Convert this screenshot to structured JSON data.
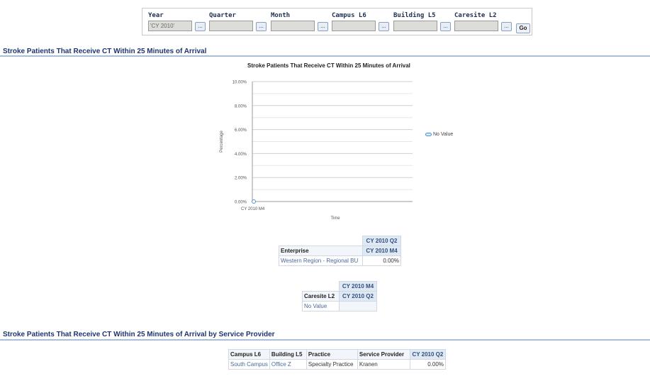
{
  "prompts": {
    "year": {
      "label": "Year",
      "value": "'CY 2010'"
    },
    "quarter": {
      "label": "Quarter",
      "value": ""
    },
    "month": {
      "label": "Month",
      "value": ""
    },
    "campus_l6": {
      "label": "Campus L6",
      "value": ""
    },
    "building_l5": {
      "label": "Building L5",
      "value": ""
    },
    "caresite_l2": {
      "label": "Caresite L2",
      "value": ""
    },
    "browse_label": "...",
    "go_label": "Go"
  },
  "section1": {
    "title": "Stroke Patients That Receive CT Within 25 Minutes of Arrival"
  },
  "chart_data": {
    "type": "line",
    "title": "Stroke Patients That Receive CT Within 25 Minutes of Arrival",
    "xlabel": "Time",
    "ylabel": "Percentage",
    "categories": [
      "CY 2010 M4"
    ],
    "series": [
      {
        "name": "No Value",
        "values": [
          0.0
        ]
      }
    ],
    "ylim": [
      0,
      10
    ],
    "yticks": [
      "0.00%",
      "2.00%",
      "4.00%",
      "6.00%",
      "8.00%",
      "10.00%"
    ],
    "grid": true,
    "legend": "right",
    "series_color": "#4a90d9"
  },
  "table1": {
    "col_top": "CY 2010 Q2",
    "row_header": "Enterprise",
    "col_sub": "CY 2010 M4",
    "rows": [
      {
        "label": "Western Region - Regional BU",
        "value": "0.00%"
      }
    ]
  },
  "table2": {
    "col_top": "CY 2010 M4",
    "row_header": "Caresite L2",
    "col_sub": "CY 2010 Q2",
    "rows": [
      {
        "label": "No Value",
        "value": ""
      }
    ]
  },
  "section2": {
    "title": "Stroke Patients That Receive CT Within 25 Minutes of Arrival by Service Provider"
  },
  "table3": {
    "headers": [
      "Campus L6",
      "Building L5",
      "Practice",
      "Service Provider",
      "CY 2010 Q2"
    ],
    "rows": [
      [
        "South Campus",
        "Office Z",
        "Specialty Practice",
        "Kranen",
        "0.00%"
      ]
    ]
  }
}
